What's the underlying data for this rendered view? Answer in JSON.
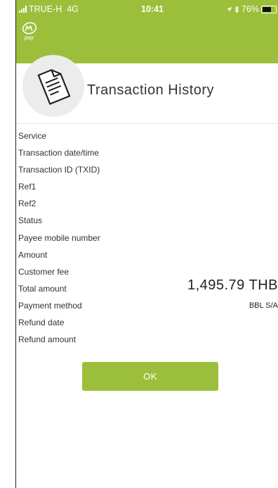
{
  "status_bar": {
    "carrier": "TRUE-H",
    "network": "4G",
    "time": "10:41",
    "battery": "76%",
    "battery_level": 0.76
  },
  "app": {
    "logo_text": "pay"
  },
  "page": {
    "title": "Transaction History"
  },
  "fields": [
    {
      "label": "Service",
      "value": ""
    },
    {
      "label": "Transaction date/time",
      "value": ""
    },
    {
      "label": "Transaction ID (TXID)",
      "value": ""
    },
    {
      "label": "Ref1",
      "value": ""
    },
    {
      "label": "Ref2",
      "value": ""
    },
    {
      "label": "Status",
      "value": ""
    },
    {
      "label": "Payee mobile number",
      "value": ""
    },
    {
      "label": "Amount",
      "value": ""
    },
    {
      "label": "Customer fee",
      "value": ""
    },
    {
      "label": "Total amount",
      "value": "1,495.79 THB"
    },
    {
      "label": "Payment method",
      "value": "BBL S/A"
    },
    {
      "label": "Refund date",
      "value": ""
    },
    {
      "label": "Refund amount",
      "value": ""
    }
  ],
  "buttons": {
    "ok_label": "OK"
  },
  "colors": {
    "brand_green": "#9cbf3b",
    "text_dark": "#333333",
    "icon_circle": "#ececec"
  }
}
